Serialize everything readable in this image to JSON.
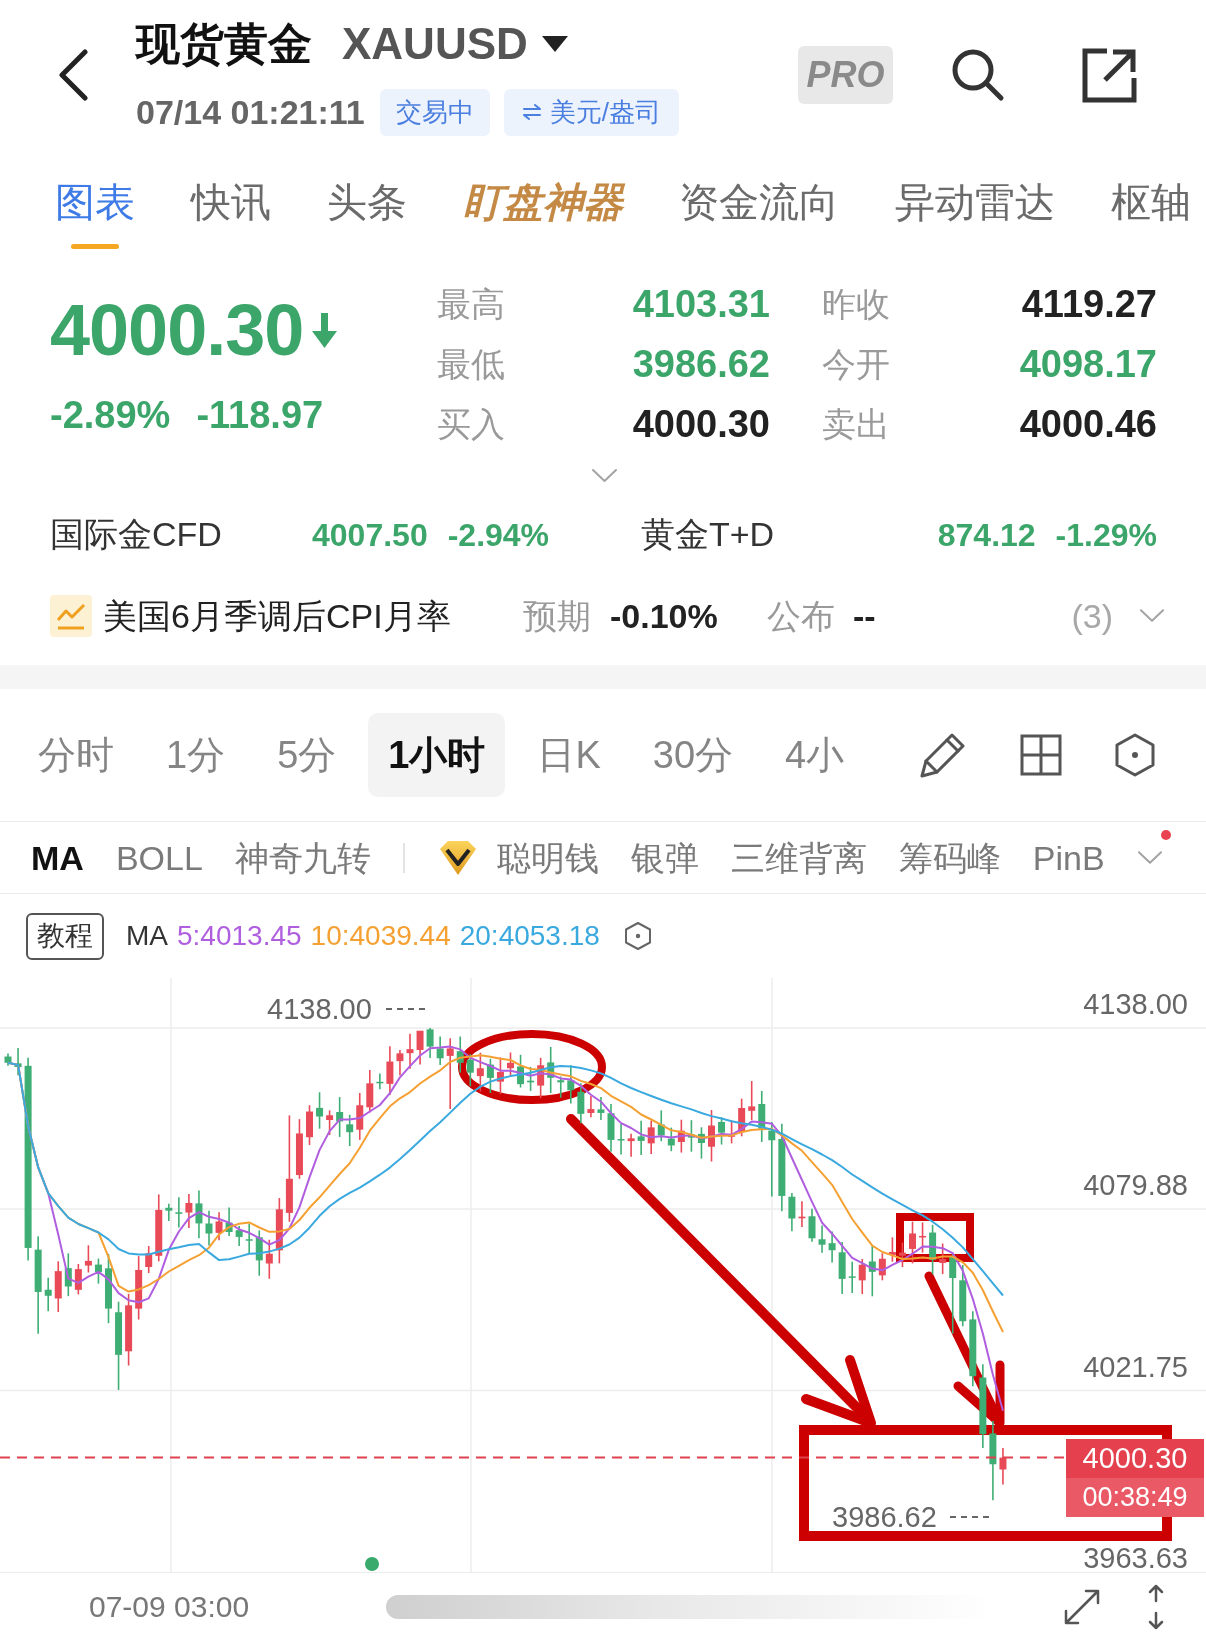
{
  "header": {
    "title": "现货黄金",
    "symbol": "XAUUSD",
    "time": "07/14 01:21:11",
    "status": "交易中",
    "unit": "美元/盎司",
    "pro": "PRO"
  },
  "tabs": [
    {
      "label": "图表",
      "selected": true,
      "kind": "plain"
    },
    {
      "label": "快讯",
      "selected": false,
      "kind": "plain"
    },
    {
      "label": "头条",
      "selected": false,
      "kind": "plain"
    },
    {
      "label": "盯盘神器",
      "selected": false,
      "kind": "featured"
    },
    {
      "label": "资金流向",
      "selected": false,
      "kind": "plain"
    },
    {
      "label": "异动雷达",
      "selected": false,
      "kind": "plain"
    },
    {
      "label": "枢轴",
      "selected": false,
      "kind": "plain"
    }
  ],
  "quote": {
    "price": "4000.30",
    "falling": true,
    "change_percent": "-2.89%",
    "change": "-118.97",
    "stats": [
      {
        "label": "最高",
        "value": "4103.31",
        "falling": true
      },
      {
        "label": "昨收",
        "value": "4119.27",
        "falling": false
      },
      {
        "label": "最低",
        "value": "3986.62",
        "falling": true
      },
      {
        "label": "今开",
        "value": "4098.17",
        "falling": true
      },
      {
        "label": "买入",
        "value": "4000.30",
        "falling": false
      },
      {
        "label": "卖出",
        "value": "4000.46",
        "falling": false
      }
    ]
  },
  "related_markets": [
    {
      "name": "国际金CFD",
      "price": "4007.50",
      "change_percent": "-2.94%",
      "falling": true
    },
    {
      "name": "黄金T+D",
      "price": "874.12",
      "change_percent": "-1.29%",
      "falling": true
    }
  ],
  "event": {
    "title": "美国6月季调后CPI月率",
    "expected_label": "预期",
    "expected": "-0.10%",
    "actual_label": "公布",
    "actual": "--",
    "count": "(3)"
  },
  "periods": [
    {
      "label": "分时",
      "selected": false
    },
    {
      "label": "1分",
      "selected": false
    },
    {
      "label": "5分",
      "selected": false
    },
    {
      "label": "1小时",
      "selected": true
    },
    {
      "label": "日K",
      "selected": false
    },
    {
      "label": "30分",
      "selected": false
    },
    {
      "label": "4小",
      "selected": false
    }
  ],
  "indicators": {
    "basic": [
      {
        "label": "MA",
        "selected": true
      },
      {
        "label": "BOLL",
        "selected": false
      },
      {
        "label": "神奇九转",
        "selected": false
      }
    ],
    "featured": [
      {
        "label": "聪明钱",
        "selected": false,
        "kind": "premium"
      },
      {
        "label": "银弹",
        "selected": false,
        "kind": "plain"
      },
      {
        "label": "三维背离",
        "selected": false,
        "kind": "plain"
      },
      {
        "label": "筹码峰",
        "selected": false,
        "kind": "plain"
      },
      {
        "label": "PinB",
        "selected": false,
        "kind": "plain"
      }
    ],
    "more_new_dot": true
  },
  "chart": {
    "tutorial": "教程",
    "ma_label": "MA",
    "ma_values": [
      {
        "label": "5:4013.45",
        "color": "#b05ee0"
      },
      {
        "label": "10:4039.44",
        "color": "#f5a032"
      },
      {
        "label": "20:4053.18",
        "color": "#3aa9df"
      }
    ],
    "y_axis": [
      "4138.00",
      "4079.88",
      "4021.75",
      "3963.63"
    ],
    "high_marker": "4138.00",
    "low_marker": "3986.62",
    "price_tag": {
      "price": "4000.30",
      "countdown": "00:38:49"
    },
    "x_axis": [
      "07-09 03:00"
    ]
  }
}
